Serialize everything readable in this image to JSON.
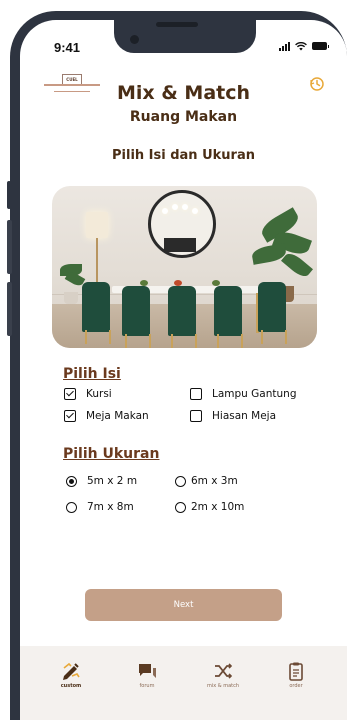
{
  "status_bar": {
    "time": "9:41"
  },
  "logo": {
    "text": "CUEL"
  },
  "header": {
    "title": "Mix & Match",
    "subtitle": "Ruang Makan"
  },
  "page_heading": "Pilih Isi dan Ukuran",
  "isi": {
    "label": "Pilih Isi",
    "options": [
      {
        "label": "Kursi",
        "checked": true
      },
      {
        "label": "Lampu Gantung",
        "checked": false
      },
      {
        "label": "Meja Makan",
        "checked": true
      },
      {
        "label": "Hiasan Meja",
        "checked": false
      }
    ]
  },
  "ukuran": {
    "label": "Pilih Ukuran",
    "options": [
      {
        "label": "5m x 2 m",
        "selected": true
      },
      {
        "label": "6m x 3m",
        "selected": false
      },
      {
        "label": "7m x 8m",
        "selected": false
      },
      {
        "label": "2m x 10m",
        "selected": false
      }
    ]
  },
  "next_button": {
    "label": "Next"
  },
  "bottom_nav": [
    {
      "label": "custom",
      "icon": "custom-icon",
      "active": true
    },
    {
      "label": "forum",
      "icon": "forum-icon",
      "active": false
    },
    {
      "label": "mix & match",
      "icon": "shuffle-icon",
      "active": false
    },
    {
      "label": "order",
      "icon": "clipboard-icon",
      "active": false
    }
  ],
  "colors": {
    "heading": "#4a2e16",
    "section": "#6b3a1e",
    "button": "#c4a088",
    "accent_icon": "#e8a93a"
  }
}
